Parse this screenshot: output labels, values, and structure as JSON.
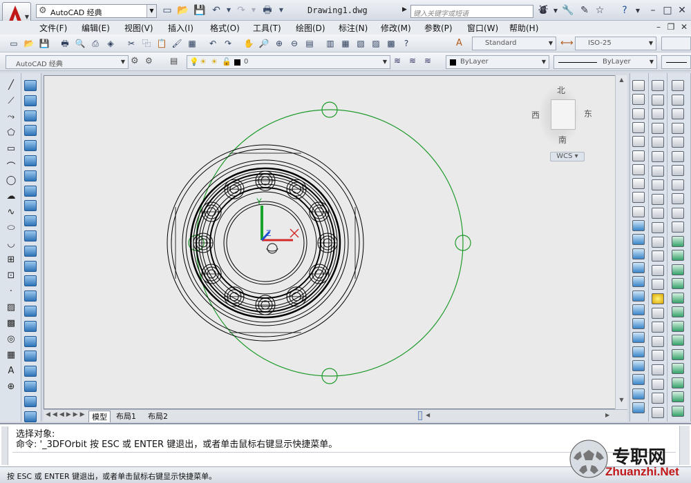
{
  "title_bar": {
    "workspace": "AutoCAD 经典",
    "document_title": "Drawing1.dwg",
    "search_placeholder": "键入关键字或短语"
  },
  "menus": [
    "文件(F)",
    "编辑(E)",
    "视图(V)",
    "插入(I)",
    "格式(O)",
    "工具(T)",
    "绘图(D)",
    "标注(N)",
    "修改(M)",
    "参数(P)",
    "窗口(W)",
    "帮助(H)"
  ],
  "styles_toolbar": {
    "text_style": "Standard",
    "dim_style": "ISO-25"
  },
  "layers_toolbar": {
    "workspace": "AutoCAD 经典",
    "layer": "0",
    "color": "ByLayer",
    "linetype": "ByLayer"
  },
  "viewcube": {
    "north": "北",
    "south": "南",
    "east": "东",
    "west": "西",
    "wcs": "WCS"
  },
  "tabs": [
    "模型",
    "布局1",
    "布局2"
  ],
  "command": {
    "line1": "选择对象:",
    "line2": "命令: '_3DFOrbit 按 ESC 或 ENTER 键退出，或者单击鼠标右键显示快捷菜单。"
  },
  "status_bar": "按 ESC 或 ENTER 键退出，或者单击鼠标右键显示快捷菜单。",
  "watermark": {
    "cn": "专职网",
    "url": "Zhuanzhi.Net"
  },
  "colors": {
    "orbit_green": "#1e9a2a",
    "ucs_x": "#d42a2a",
    "ucs_y": "#16a22c",
    "ucs_z": "#1e4fd4",
    "canvas_bg": "#eaeaea",
    "accent_red": "#c01818"
  }
}
